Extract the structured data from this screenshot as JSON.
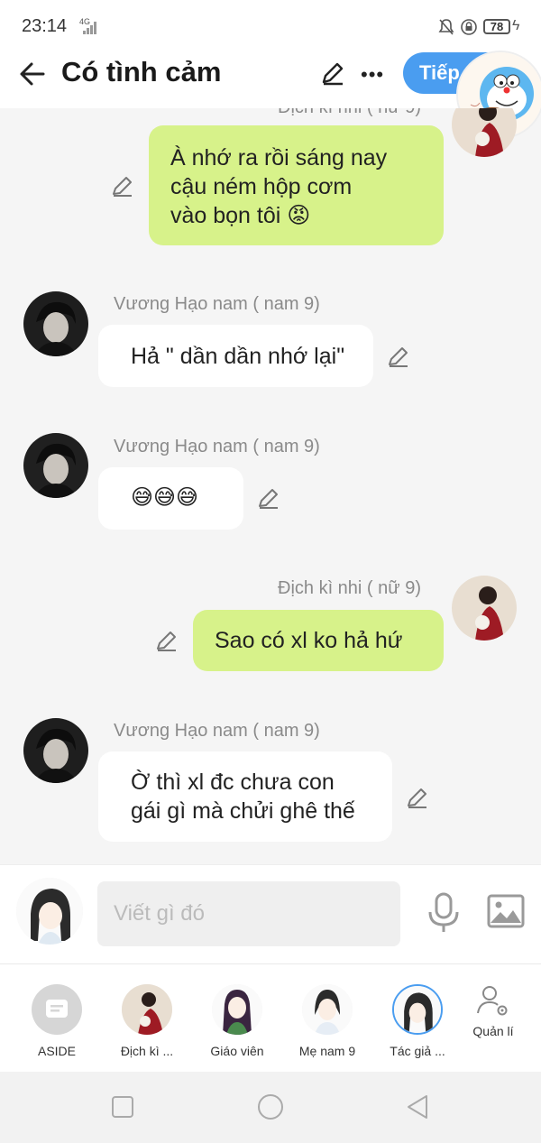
{
  "status_bar": {
    "time": "23:14",
    "network": "4G",
    "battery": "78"
  },
  "header": {
    "title": "Có tình cảm",
    "next_label": "Tiếp"
  },
  "chat": {
    "partial_name": "Địch kì nhi ( nữ 9)",
    "messages": [
      {
        "side": "sent",
        "sender": "",
        "text_lines": [
          "À nhớ ra rồi sáng nay",
          "cậu ném hộp cơm",
          "vào bọn tôi 😡"
        ]
      },
      {
        "side": "received",
        "sender": "Vương Hạo nam ( nam 9)",
        "text_lines": [
          "Hả \" dần dần nhớ lại\""
        ]
      },
      {
        "side": "received",
        "sender": "Vương Hạo nam ( nam 9)",
        "text_lines": [
          "😅😅😅"
        ]
      },
      {
        "side": "sent",
        "sender": "Địch kì nhi ( nữ 9)",
        "text_lines": [
          "Sao có xl ko hả hứ"
        ]
      },
      {
        "side": "received",
        "sender": "Vương Hạo nam ( nam 9)",
        "text_lines": [
          "Ờ thì xl đc chưa con",
          "gái gì mà chửi ghê thế"
        ]
      }
    ]
  },
  "input": {
    "placeholder": "Viết gì đó"
  },
  "characters": [
    {
      "label": "ASIDE",
      "icon": "chat-bubble-icon"
    },
    {
      "label": "Địch kì ...",
      "icon": "avatar"
    },
    {
      "label": "Giáo viên",
      "icon": "avatar"
    },
    {
      "label": "Mẹ nam 9",
      "icon": "avatar"
    },
    {
      "label": "Tác giả ...",
      "icon": "avatar"
    }
  ],
  "manage": {
    "label": "Quản lí",
    "icon": "user-gear-icon"
  },
  "colors": {
    "sent_bubble": "#d7f28a",
    "recv_bubble": "#ffffff",
    "accent": "#4a9df0",
    "background": "#f5f5f5"
  }
}
